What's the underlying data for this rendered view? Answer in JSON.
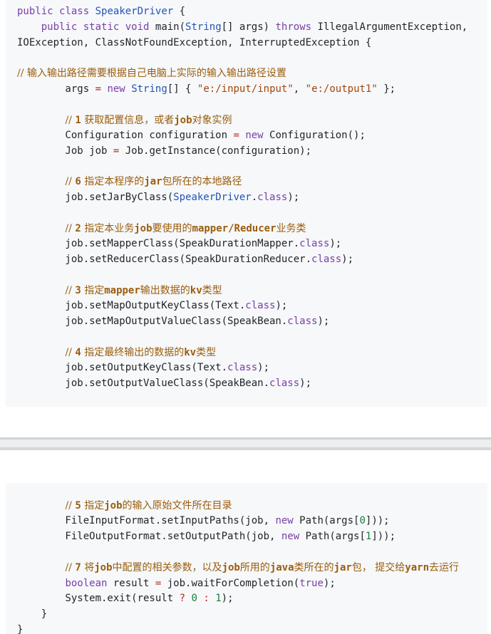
{
  "code_block_1": {
    "lines": [
      "public class SpeakerDriver {",
      "    public static void main(String[] args) throws IllegalArgumentException,",
      "IOException, ClassNotFoundException, InterruptedException {",
      "",
      "// 输入输出路径需要根据自己电脑上实际的输入输出路径设置",
      "        args = new String[] { \"e:/input/input\", \"e:/output1\" };",
      "",
      "        // 1 获取配置信息，或者job对象实例",
      "        Configuration configuration = new Configuration();",
      "        Job job = Job.getInstance(configuration);",
      "",
      "        // 6 指定本程序的jar包所在的本地路径",
      "        job.setJarByClass(SpeakerDriver.class);",
      "",
      "        // 2 指定本业务job要使用的mapper/Reducer业务类",
      "        job.setMapperClass(SpeakDurationMapper.class);",
      "        job.setReducerClass(SpeakDurationReducer.class);",
      "",
      "        // 3 指定mapper输出数据的kv类型",
      "        job.setMapOutputKeyClass(Text.class);",
      "        job.setMapOutputValueClass(SpeakBean.class);",
      "",
      "        // 4 指定最终输出的数据的kv类型",
      "        job.setOutputKeyClass(Text.class);",
      "        job.setOutputValueClass(SpeakBean.class);"
    ]
  },
  "code_block_2": {
    "lines": [
      "        // 5 指定job的输入原始文件所在目录",
      "        FileInputFormat.setInputPaths(job, new Path(args[0]));",
      "        FileOutputFormat.setOutputPath(job, new Path(args[1]));",
      "",
      "        // 7 将job中配置的相关参数，以及job所用的java类所在的jar包， 提交给yarn去运行",
      "        boolean result = job.waitForCompletion(true);",
      "        System.exit(result ? 0 : 1);",
      "    }",
      "}"
    ]
  },
  "colors": {
    "code_background": "#f6f8fa",
    "keyword": "#7a3ea6",
    "type": "#2553b3",
    "string": "#a1470a",
    "number": "#1a7f37",
    "comment": "#9b5c0c",
    "operator": "#b52a1d"
  }
}
